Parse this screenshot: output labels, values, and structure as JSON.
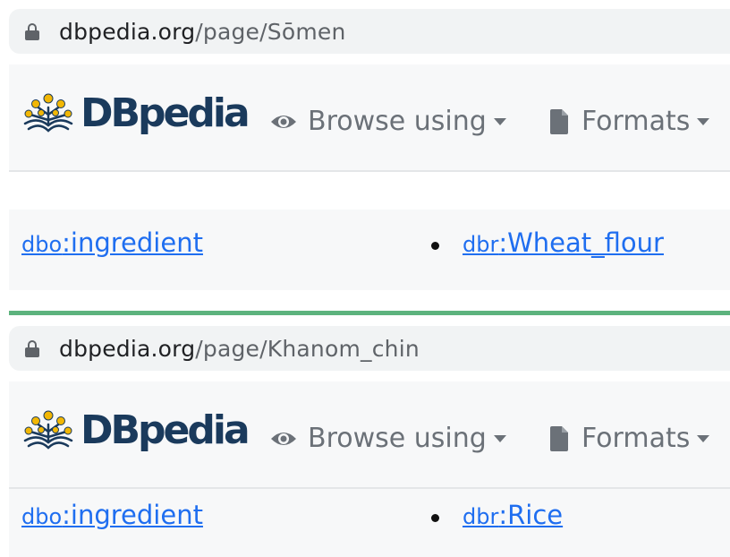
{
  "panels": [
    {
      "url_domain": "dbpedia.org",
      "url_path": "/page/Sōmen",
      "brand": "DBpedia",
      "nav": {
        "browse": "Browse using",
        "formats": "Formats"
      },
      "property": {
        "prefix": "dbo",
        "local": ":ingredient"
      },
      "value": {
        "prefix": "dbr",
        "local": ":Wheat_flour"
      }
    },
    {
      "url_domain": "dbpedia.org",
      "url_path": "/page/Khanom_chin",
      "brand": "DBpedia",
      "nav": {
        "browse": "Browse using",
        "formats": "Formats"
      },
      "property": {
        "prefix": "dbo",
        "local": ":ingredient"
      },
      "value": {
        "prefix": "dbr",
        "local": ":Rice"
      }
    }
  ],
  "colors": {
    "link": "#1f6ef0",
    "brand": "#1a3a5c",
    "divider": "#5db37e"
  },
  "icons": [
    "lock-icon",
    "dbpedia-logo-icon",
    "eye-icon",
    "document-icon",
    "caret-down-icon"
  ]
}
